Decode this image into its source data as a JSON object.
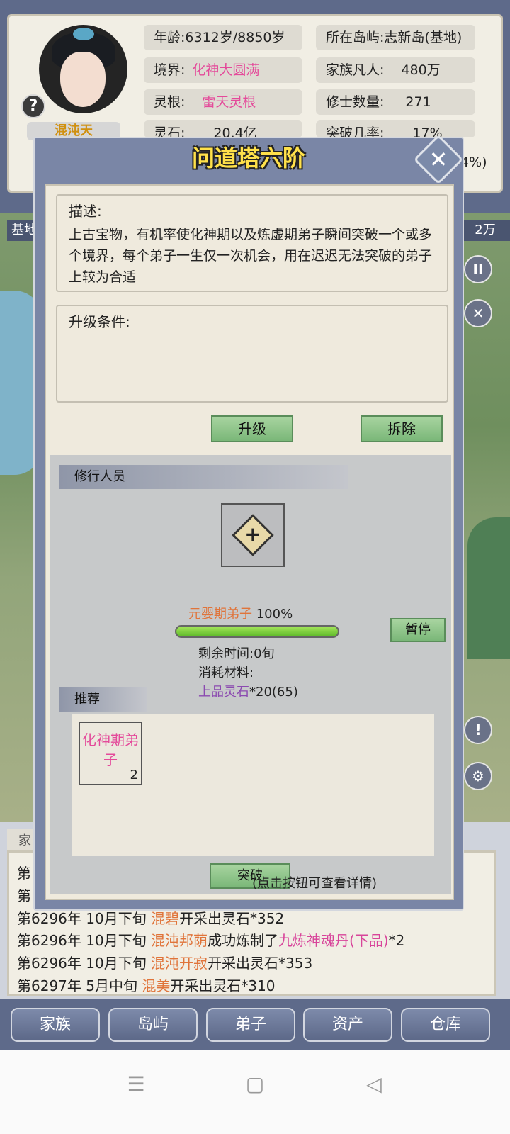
{
  "character": {
    "name": "混沌天",
    "stats": {
      "age": "年龄:6312岁/8850岁",
      "island": "所在岛屿:志新岛(基地)",
      "realm_label": "境界:",
      "realm_value": "化神大圆满",
      "family_label": "家族凡人:",
      "family_value": "480万",
      "root_label": "灵根:",
      "root_value": "雷天灵根",
      "cultivators_label": "修士数量:",
      "cultivators_value": "271",
      "stones_label": "灵石:",
      "stones_value": "20.4亿",
      "breakthrough_label": "突破几率:",
      "breakthrough_value": "17%",
      "partial_right": "4%)"
    },
    "help_icon": "?"
  },
  "scene": {
    "base_label": "基地",
    "wan_label": "2万",
    "pause_icon": "II",
    "close_icon": "✕",
    "alert_icon": "!",
    "settings_icon": "⚙"
  },
  "modal": {
    "title": "问道塔六阶",
    "close_icon": "✕",
    "description": {
      "label": "描述:",
      "text": "上古宝物，有机率使化神期以及炼虚期弟子瞬间突破一个或多个境界，每个弟子一生仅一次机会，用在迟迟无法突破的弟子上较为合适"
    },
    "upgrade_conditions": {
      "label": "升级条件:"
    },
    "buttons": {
      "upgrade": "升级",
      "demolish": "拆除",
      "pause": "暂停",
      "breakthrough": "突破"
    },
    "trainees": {
      "header": "修行人员",
      "add_icon": "+",
      "progress_name": "元婴期弟子",
      "progress_percent": "100%",
      "progress_value": 1.0,
      "remaining_time": "剩余时间:0旬",
      "materials_label": "消耗材料:",
      "material_name": "上品灵石",
      "material_qty": "*20(65)"
    },
    "recommend": {
      "header": "推荐",
      "items": [
        {
          "name": "化神期弟子",
          "count": "2"
        }
      ]
    },
    "hint": "(点击按钮可查看详情)"
  },
  "log": {
    "tab": "家",
    "lines": [
      {
        "prefix": "第",
        "name": "",
        "rest": ""
      },
      {
        "prefix": "第",
        "name": "",
        "rest": ""
      },
      {
        "prefix": "第6296年 10月下旬 ",
        "name": "混碧",
        "rest": "开采出灵石*352"
      },
      {
        "prefix": "第6296年 10月下旬 ",
        "name": "混沌邦荫",
        "rest": "成功炼制了",
        "item": "九炼神魂丹(下品)",
        "tail": "*2"
      },
      {
        "prefix": "第6296年 10月下旬 ",
        "name": "混沌开寂",
        "rest": "开采出灵石*353"
      },
      {
        "prefix": "第6297年 5月中旬 ",
        "name": "混美",
        "rest": "开采出灵石*310"
      }
    ]
  },
  "nav": {
    "items": [
      "家族",
      "岛屿",
      "弟子",
      "资产",
      "仓库"
    ]
  },
  "system_nav": {
    "menu_icon": "☰",
    "home_icon": "▢",
    "back_icon": "◁"
  },
  "colors": {
    "title_yellow": "#ffe14a",
    "highlight_pink": "#e44a9a",
    "name_orange": "#e0743a",
    "material_purple": "#8b4ab0",
    "progress_green": "#7fd23a"
  }
}
